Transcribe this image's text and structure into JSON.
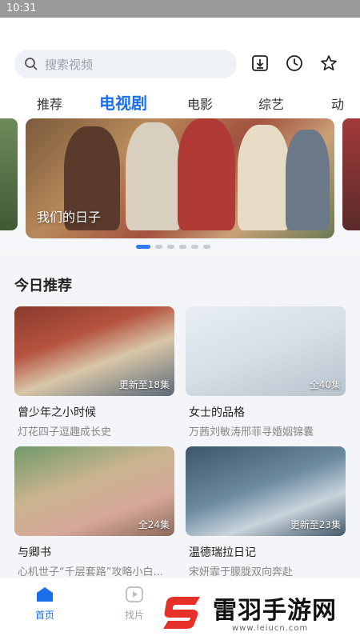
{
  "status_bar": {
    "time": "10:31"
  },
  "header": {
    "search_placeholder": "搜索视频",
    "icons": [
      "download-icon",
      "history-clock-icon",
      "favorite-star-icon"
    ]
  },
  "tabs": [
    "推荐",
    "电视剧",
    "电影",
    "综艺",
    "动"
  ],
  "active_tab": "电视剧",
  "banner": {
    "title": "我们的日子",
    "page_count": 6,
    "active_index": 0
  },
  "section": {
    "title": "今日推荐"
  },
  "cards": [
    {
      "title": "曾少年之小时候",
      "subtitle": "灯花四子逗趣成长史",
      "badge": "更新至18集"
    },
    {
      "title": "女士的品格",
      "subtitle": "万茜刘敏涛邢菲寻婚姻锦囊",
      "badge": "全40集"
    },
    {
      "title": "与卿书",
      "subtitle": "心机世子“千层套路”攻略小白...",
      "badge": "全24集"
    },
    {
      "title": "温德瑞拉日记",
      "subtitle": "宋妍霏于朦胧双向奔赴",
      "badge": "更新至23集"
    }
  ],
  "bottom_nav": [
    {
      "label": "首页",
      "icon": "home-icon",
      "active": true
    },
    {
      "label": "找片",
      "icon": "play-icon",
      "active": false
    }
  ],
  "watermark": {
    "text": "雷羽手游网",
    "url": "www.leiucn.com"
  },
  "colors": {
    "accent": "#1a6fe8",
    "dot_active": "#2f7cf0",
    "watermark_red": "#e8302a"
  }
}
